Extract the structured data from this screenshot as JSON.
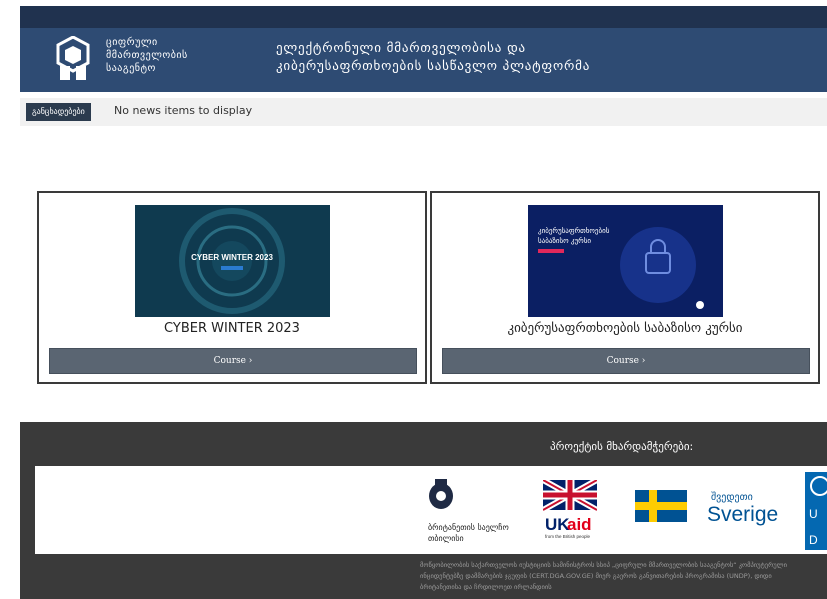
{
  "header": {
    "agency_lines": [
      "ციფრული",
      "მმართველობის",
      "სააგენტო"
    ],
    "platform_lines": [
      "ელექტრონული მმართველობისა და",
      "კიბერუსაფრთხოების სასწავლო პლატფორმა"
    ]
  },
  "news": {
    "label": "განცხადებები",
    "text": "No news items to display"
  },
  "courses": [
    {
      "title": "CYBER WINTER 2023",
      "thumb_text": "CYBER WINTER 2023",
      "button": "Course ›"
    },
    {
      "title": "კიბერუსაფრთხოების საბაზისო კურსი",
      "thumb_text_lines": [
        "კიბერუსაფრთხოების",
        "საბაზისო კურსი"
      ],
      "button": "Course ›"
    }
  ],
  "footer": {
    "sponsors_title": "პროექტის მხარდამჭერები:",
    "sponsors": [
      {
        "name_lines": [
          "ბრიტანეთის საელჩო",
          "თბილისი"
        ],
        "icon": "uk-crest-icon"
      },
      {
        "name": "UKaid",
        "sub": "from the British people",
        "icon": "ukaid-flag-icon"
      },
      {
        "label": "შვედეთი",
        "name": "Sverige",
        "icon": "sweden-flag-icon"
      },
      {
        "name": "UNDP",
        "icon": "undp-icon"
      }
    ],
    "footnote": "მოწყობილობის საქართველოს იუსტიციის სამინისტროს სსიპ „ციფრული მმართველობის სააგენტოს“ კომპიუტერული ინციდენტებზე დამმარების ჯგუფის (CERT.DGA.GOV.GE) მიერ გაეროს განვითარების პროგრამისა (UNDP), დიდი ბრიტანეთისა და ჩრდილოეთ ირლანდიის"
  },
  "colors": {
    "topbar": "#20324f",
    "header": "#2e4b73",
    "footer": "#3a3a3a",
    "button": "#5a6572",
    "ukaid_red": "#e2001a",
    "sweden_blue": "#005293",
    "sweden_yellow": "#fecc02"
  }
}
